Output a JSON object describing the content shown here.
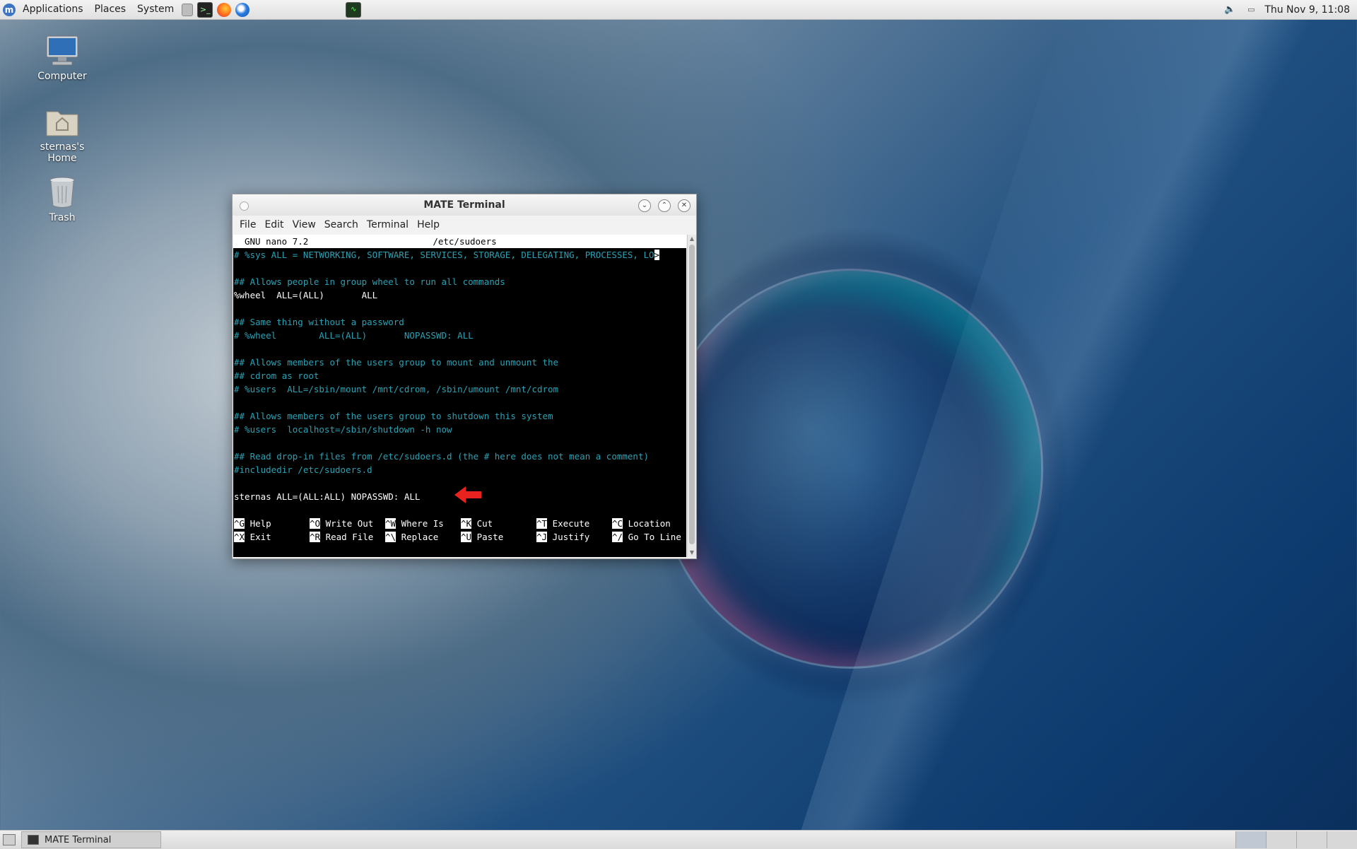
{
  "top_panel": {
    "menus": [
      "Applications",
      "Places",
      "System"
    ],
    "launchers": [
      "file-manager-icon",
      "terminal-icon",
      "firefox-icon",
      "thunderbird-icon",
      "system-monitor-icon"
    ],
    "clock": "Thu Nov 9, 11:08"
  },
  "desktop": {
    "icons": [
      {
        "label": "Computer"
      },
      {
        "label": "sternas's Home"
      },
      {
        "label": "Trash"
      }
    ]
  },
  "window": {
    "title": "MATE Terminal",
    "menus": [
      "File",
      "Edit",
      "View",
      "Search",
      "Terminal",
      "Help"
    ]
  },
  "nano": {
    "version": "GNU nano 7.2",
    "filename": "/etc/sudoers",
    "lines": [
      "# %sys ALL = NETWORKING, SOFTWARE, SERVICES, STORAGE, DELEGATING, PROCESSES, LO",
      "",
      "## Allows people in group wheel to run all commands",
      "%wheel  ALL=(ALL)       ALL",
      "",
      "## Same thing without a password",
      "# %wheel        ALL=(ALL)       NOPASSWD: ALL",
      "",
      "## Allows members of the users group to mount and unmount the",
      "## cdrom as root",
      "# %users  ALL=/sbin/mount /mnt/cdrom, /sbin/umount /mnt/cdrom",
      "",
      "## Allows members of the users group to shutdown this system",
      "# %users  localhost=/sbin/shutdown -h now",
      "",
      "## Read drop-in files from /etc/sudoers.d (the # here does not mean a comment)",
      "#includedir /etc/sudoers.d",
      "",
      "sternas ALL=(ALL:ALL) NOPASSWD: ALL"
    ],
    "shortcuts_row1": [
      {
        "key": "^G",
        "label": "Help"
      },
      {
        "key": "^O",
        "label": "Write Out"
      },
      {
        "key": "^W",
        "label": "Where Is"
      },
      {
        "key": "^K",
        "label": "Cut"
      },
      {
        "key": "^T",
        "label": "Execute"
      },
      {
        "key": "^C",
        "label": "Location"
      }
    ],
    "shortcuts_row2": [
      {
        "key": "^X",
        "label": "Exit"
      },
      {
        "key": "^R",
        "label": "Read File"
      },
      {
        "key": "^\\",
        "label": "Replace"
      },
      {
        "key": "^U",
        "label": "Paste"
      },
      {
        "key": "^J",
        "label": "Justify"
      },
      {
        "key": "^/",
        "label": "Go To Line"
      }
    ]
  },
  "bottom_panel": {
    "task_label": "MATE Terminal"
  },
  "colors": {
    "comment": "#2aa1b3",
    "annotation_arrow": "#e8231f"
  }
}
